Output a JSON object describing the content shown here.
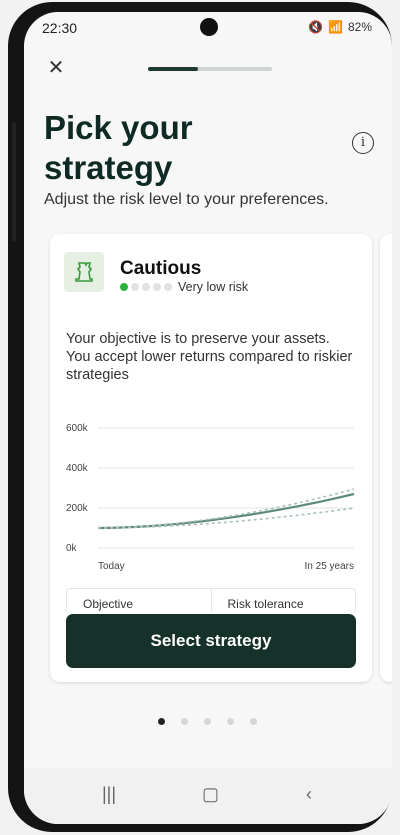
{
  "status": {
    "time": "22:30",
    "battery": "82%"
  },
  "header": {
    "title_line1": "Pick your",
    "title_line2": "strategy",
    "subtitle": "Adjust the risk level to your preferences."
  },
  "progress": {
    "fraction": 0.4
  },
  "card": {
    "name": "Cautious",
    "risk_label": "Very low risk",
    "risk_level": 1,
    "risk_max": 5,
    "description": "Your objective is to preserve your assets. You accept lower returns compared to riskier strategies",
    "tabs": [
      "Objective",
      "Risk tolerance"
    ],
    "button": "Select strategy"
  },
  "chart_data": {
    "type": "line",
    "x": [
      "Today",
      "In 25 years"
    ],
    "y_ticks": [
      "600k",
      "400k",
      "200k",
      "0k"
    ],
    "ylim": [
      0,
      600000
    ],
    "series": [
      {
        "values": [
          100000,
          270000
        ],
        "style": "solid",
        "color": "#5e8a7a"
      },
      {
        "values": [
          100000,
          295000
        ],
        "style": "dashed",
        "color": "#a9c0b8"
      },
      {
        "values": [
          100000,
          200000
        ],
        "style": "dashed",
        "color": "#a9c0b8"
      }
    ]
  },
  "pager": {
    "count": 5,
    "active": 0
  },
  "icons": {
    "close": "close-icon",
    "info": "info-icon",
    "strategy": "chess-icon"
  },
  "colors": {
    "primary": "#15312a",
    "risk_on": "#2bb33a"
  }
}
